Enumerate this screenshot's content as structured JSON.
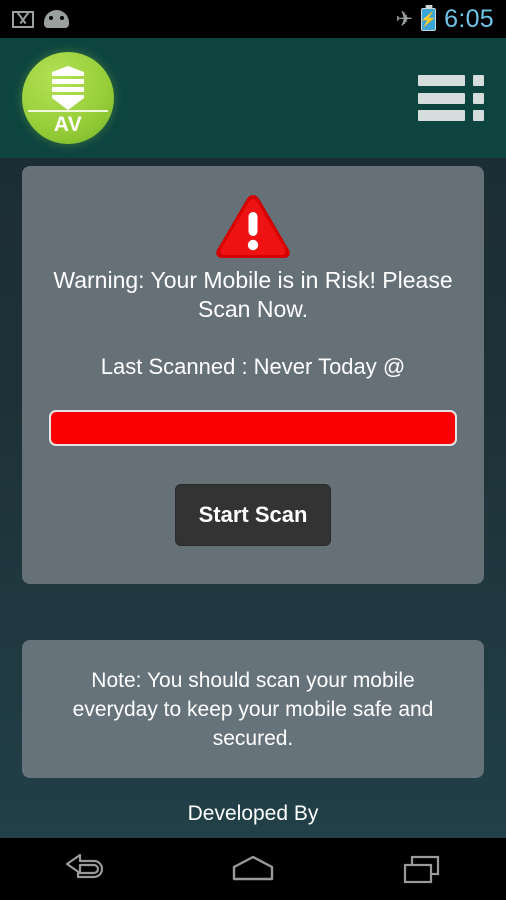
{
  "status_bar": {
    "icons": [
      {
        "name": "gmail-icon",
        "label": "Gmail"
      },
      {
        "name": "android-icon",
        "label": "Android"
      },
      {
        "name": "airplane-mode-icon",
        "glyph": "✈"
      },
      {
        "name": "battery-charging-icon",
        "glyph": "⚡"
      }
    ],
    "clock": "6:05"
  },
  "header": {
    "logo": {
      "name": "antivirus-logo",
      "text": "AV",
      "circle_color": "#98cf3b",
      "shield_color": "#ffffff"
    },
    "menu": {
      "name": "menu-icon",
      "label": "Menu",
      "rows": 3,
      "color": "#d6dedd"
    },
    "background_color": "#0d4440"
  },
  "main": {
    "warning_icon": {
      "name": "warning-triangle-icon",
      "color": "#e00000",
      "mark": "!"
    },
    "warning_text": "Warning: Your Mobile is in Risk! Please Scan Now.",
    "last_scanned_label": "Last Scanned : Never Today @",
    "progress": {
      "name": "scan-progress-bar",
      "value": 100,
      "fill_color": "#fb0000",
      "border_color": "#e3e6e6"
    },
    "scan_button_label": "Start Scan",
    "card_color": "#657077"
  },
  "note": {
    "text": "Note: You should scan your mobile everyday to keep your mobile safe and secured.",
    "card_color": "#66737a"
  },
  "footer": {
    "credit": "Developed By"
  },
  "nav_bar": {
    "buttons": [
      {
        "name": "nav-back-button",
        "label": "Back"
      },
      {
        "name": "nav-home-button",
        "label": "Home"
      },
      {
        "name": "nav-recents-button",
        "label": "Recents"
      }
    ],
    "icon_color": "#9a9a9a"
  },
  "theme": {
    "background_top": "#1b2b33",
    "background_bottom": "#22424a",
    "accent_green": "#98cf3b",
    "danger_red": "#fb0000"
  }
}
